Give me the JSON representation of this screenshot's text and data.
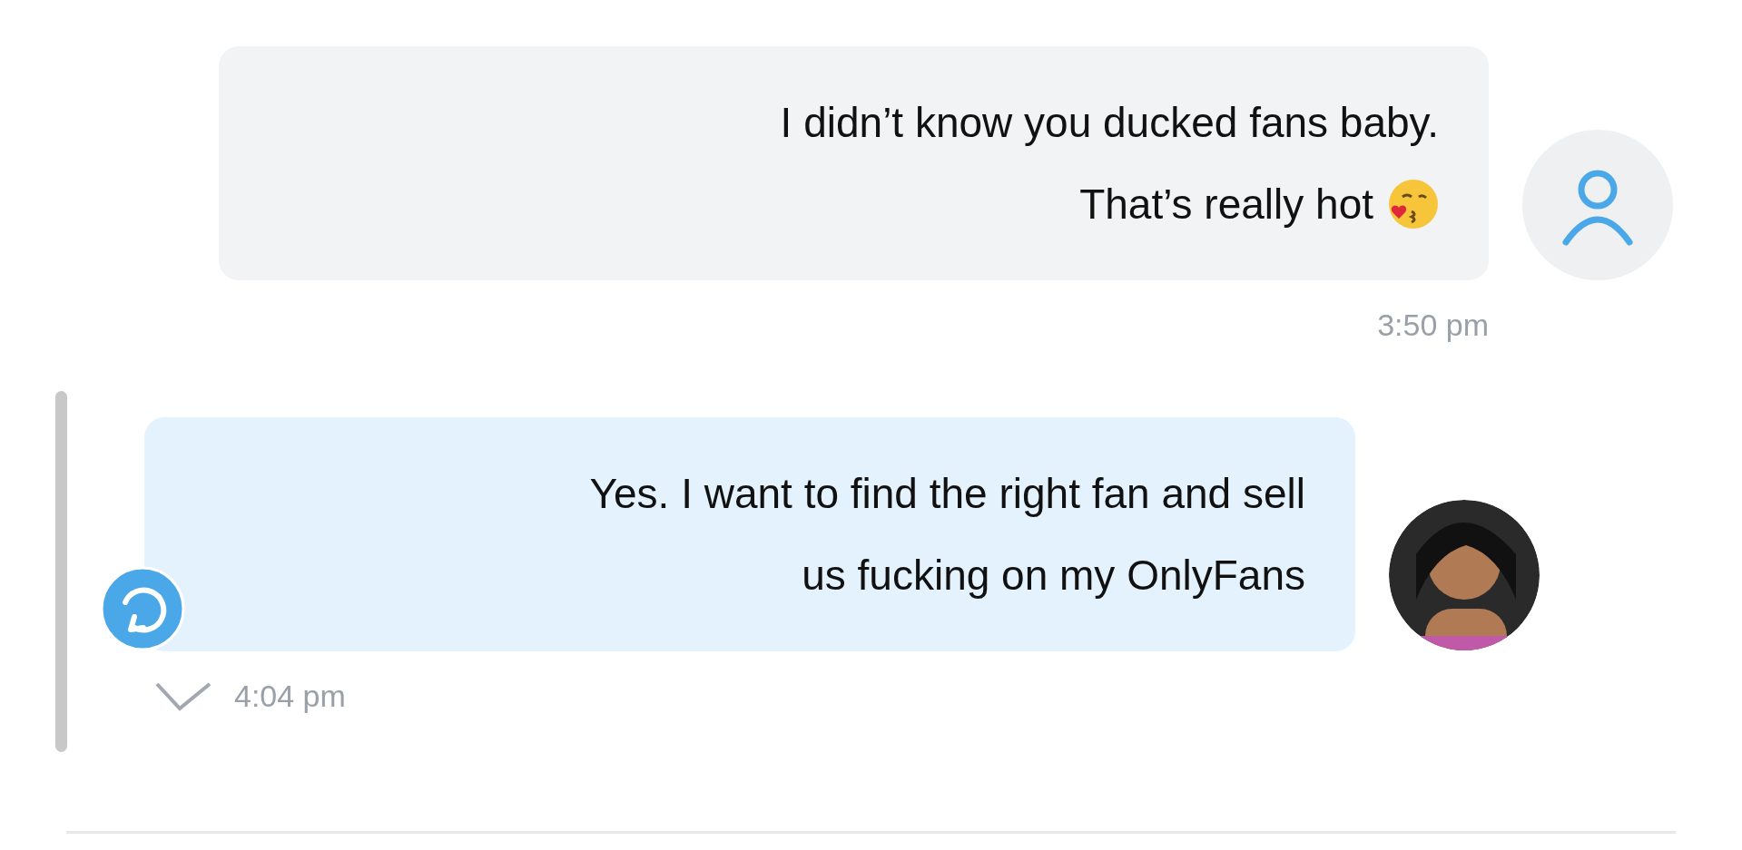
{
  "messages": [
    {
      "kind": "received",
      "lines": [
        "I didn’t know you ducked fans baby.",
        "That’s really hot"
      ],
      "emoji": true,
      "time": "3:50 pm",
      "selected": false,
      "delivered": false
    },
    {
      "kind": "sent",
      "lines": [
        "Yes. I want to find the right fan and sell",
        "us fucking on my OnlyFans"
      ],
      "emoji": false,
      "time": "4:04 pm",
      "selected": true,
      "delivered": true
    }
  ]
}
